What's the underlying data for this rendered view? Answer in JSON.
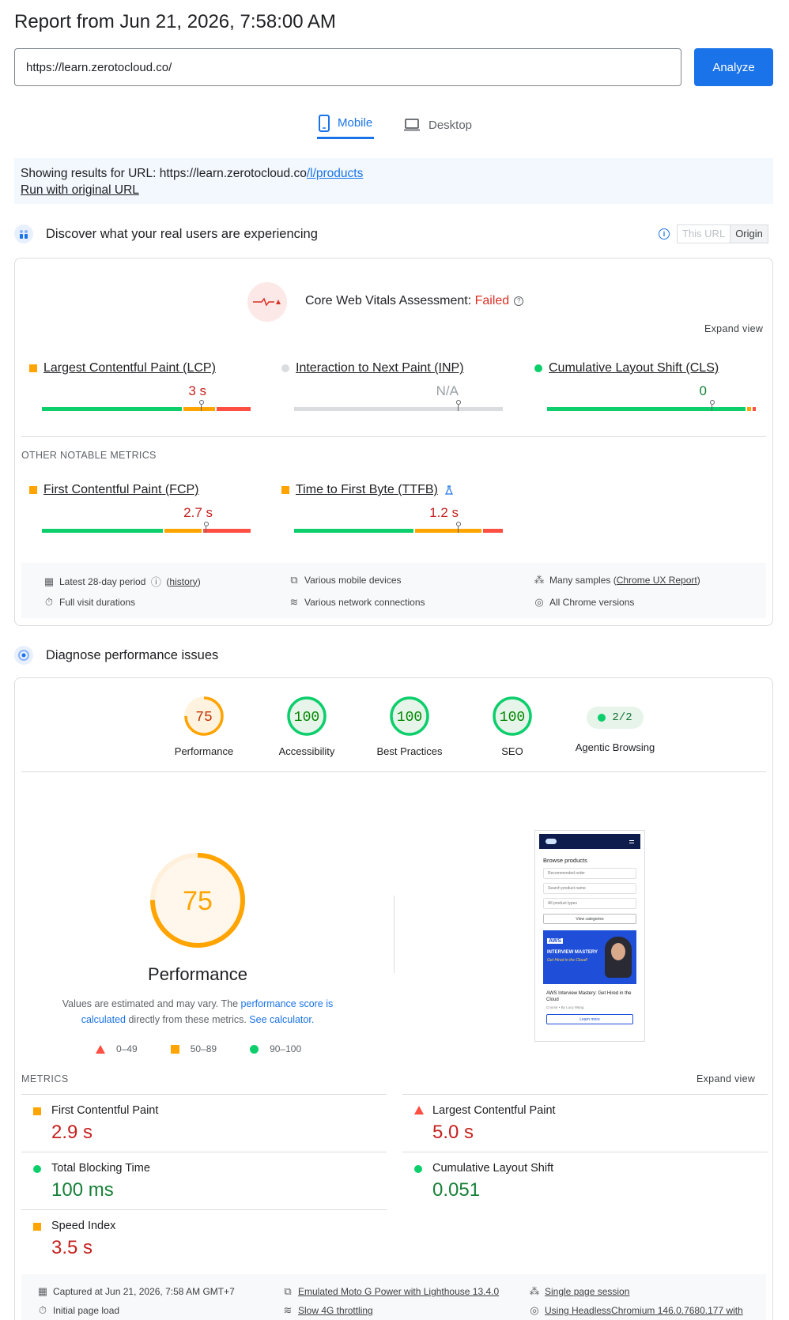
{
  "header": {
    "title": "Report from Jun 21, 2026, 7:58:00 AM",
    "url_value": "https://learn.zerotocloud.co/",
    "analyze_label": "Analyze"
  },
  "tabs": [
    {
      "label": "Mobile",
      "active": true
    },
    {
      "label": "Desktop",
      "active": false
    }
  ],
  "notice": {
    "prefix": "Showing results for URL: https://learn.zerotocloud.co",
    "path": "/l/products",
    "run_original": "Run with original URL"
  },
  "crux": {
    "title": "Discover what your real users are experiencing",
    "toggle": {
      "this_url": "This URL",
      "origin": "Origin"
    },
    "assessment_label": "Core Web Vitals Assessment: ",
    "assessment_result": "Failed",
    "expand": "Expand view",
    "core_metrics": [
      {
        "name": "Largest Contentful Paint (LCP)",
        "value": "3 s",
        "status": "needs-improvement",
        "segments": [
          0.67,
          0.16,
          0.17
        ],
        "pin": 0.75
      },
      {
        "name": "Interaction to Next Paint (INP)",
        "value": "N/A",
        "status": "none",
        "segments": [
          1.0
        ],
        "pin": 0.75
      },
      {
        "name": "Cumulative Layout Shift (CLS)",
        "value": "0",
        "status": "good",
        "segments": [
          0.96,
          0.02,
          0.02
        ],
        "pin": 0.75
      }
    ],
    "other_title": "OTHER NOTABLE METRICS",
    "other_metrics": [
      {
        "name": "First Contentful Paint (FCP)",
        "value": "2.7 s",
        "status": "needs-improvement",
        "segments": [
          0.58,
          0.18,
          0.24
        ],
        "pin": 0.75
      },
      {
        "name": "Time to First Byte (TTFB)",
        "value": "1.2 s",
        "status": "needs-improvement",
        "segments": [
          0.58,
          0.32,
          0.1
        ],
        "pin": 0.75
      }
    ],
    "footer": {
      "period": "Latest 28-day period",
      "history": "history",
      "durations": "Full visit durations",
      "devices": "Various mobile devices",
      "network": "Various network connections",
      "samples_prefix": "Many samples (",
      "samples_link": "Chrome UX Report",
      "samples_suffix": ")",
      "versions": "All Chrome versions"
    }
  },
  "diagnose": {
    "title": "Diagnose performance issues",
    "gauges": [
      {
        "label": "Performance",
        "score": "75",
        "color": "#ffa400",
        "fill": 0.75
      },
      {
        "label": "Accessibility",
        "score": "100",
        "color": "#0cce6b",
        "fill": 1.0
      },
      {
        "label": "Best Practices",
        "score": "100",
        "color": "#0cce6b",
        "fill": 1.0
      },
      {
        "label": "SEO",
        "score": "100",
        "color": "#0cce6b",
        "fill": 1.0
      }
    ],
    "agentic": {
      "label": "Agentic Browsing",
      "value": "2/2"
    },
    "big_score": "75",
    "big_label": "Performance",
    "desc_1": "Values are estimated and may vary. The ",
    "desc_link1": "performance score is calculated",
    "desc_2": " directly from these metrics. ",
    "desc_link2": "See calculator.",
    "legend": [
      "0–49",
      "50–89",
      "90–100"
    ],
    "metrics_title": "METRICS",
    "expand": "Expand view",
    "metrics": [
      {
        "name": "First Contentful Paint",
        "value": "2.9 s",
        "status": "average"
      },
      {
        "name": "Largest Contentful Paint",
        "value": "5.0 s",
        "status": "fail"
      },
      {
        "name": "Total Blocking Time",
        "value": "100 ms",
        "status": "pass"
      },
      {
        "name": "Cumulative Layout Shift",
        "value": "0.051",
        "status": "pass"
      },
      {
        "name": "Speed Index",
        "value": "3.5 s",
        "status": "average"
      }
    ],
    "thumbnail": {
      "heading": "Browse products",
      "sort": "Recommended order",
      "search": "Search product name",
      "types": "All product types",
      "categories": "View categories",
      "banner_badge": "AWS",
      "banner_title": "INTERVIEW MASTERY",
      "banner_sub": "Get Hired in the Cloud!",
      "course_title": "AWS Interview Mastery: Get Hired in the Cloud",
      "course_sub": "Course • By Lucy Wang",
      "learn_more": "Learn more"
    },
    "footer": {
      "captured": "Captured at Jun 21, 2026, 7:58 AM GMT+7",
      "initial": "Initial page load",
      "emulated": "Emulated Moto G Power with Lighthouse 13.4.0",
      "throttling": "Slow 4G throttling",
      "session": "Single page session",
      "browser": "Using HeadlessChromium 146.0.7680.177 with"
    }
  },
  "colors": {
    "accent": "#1a73e8",
    "good": "#0cce6b",
    "average": "#ffa400",
    "poor": "#ff4e42"
  }
}
